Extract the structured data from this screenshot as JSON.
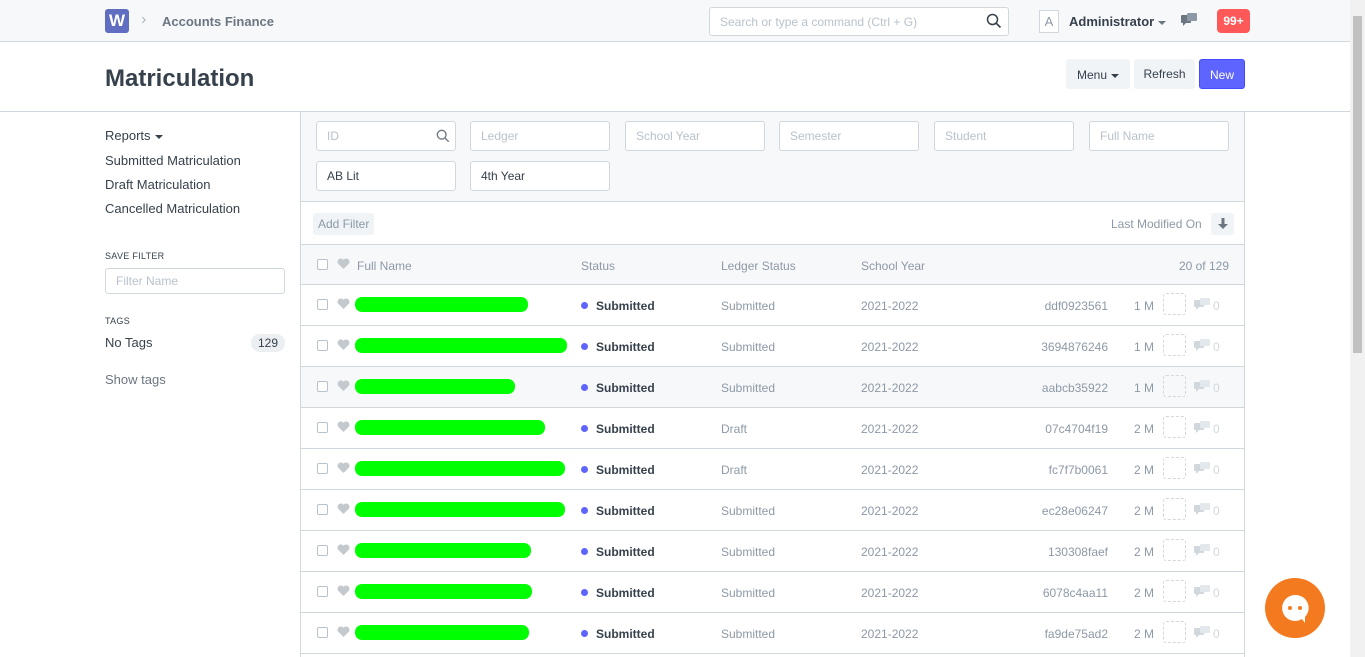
{
  "navbar": {
    "logo_letter": "W",
    "breadcrumb": "Accounts Finance",
    "search_placeholder": "Search or type a command (Ctrl + G)",
    "avatar_letter": "A",
    "user": "Administrator",
    "notification_badge": "99+"
  },
  "page": {
    "title": "Matriculation",
    "menu_label": "Menu",
    "refresh_label": "Refresh",
    "new_label": "New"
  },
  "sidebar": {
    "reports_label": "Reports",
    "links": [
      "Submitted Matriculation",
      "Draft Matriculation",
      "Cancelled Matriculation"
    ],
    "save_filter_heading": "SAVE FILTER",
    "filter_name_placeholder": "Filter Name",
    "tags_heading": "TAGS",
    "no_tags_label": "No Tags",
    "no_tags_count": "129",
    "show_tags": "Show tags"
  },
  "filters": {
    "id_placeholder": "ID",
    "ledger_placeholder": "Ledger",
    "school_year_placeholder": "School Year",
    "semester_placeholder": "Semester",
    "student_placeholder": "Student",
    "full_name_placeholder": "Full Name",
    "program_value": "AB Lit",
    "year_level_value": "4th Year",
    "add_filter": "Add Filter",
    "sort_label": "Last Modified On"
  },
  "list": {
    "columns": {
      "full_name": "Full Name",
      "status": "Status",
      "ledger_status": "Ledger Status",
      "school_year": "School Year"
    },
    "count": "20 of 129",
    "rows": [
      {
        "status": "Submitted",
        "ledger": "Submitted",
        "year": "2021-2022",
        "id": "ddf0923561",
        "time": "1 M",
        "comments": "0",
        "highlight": false
      },
      {
        "status": "Submitted",
        "ledger": "Submitted",
        "year": "2021-2022",
        "id": "3694876246",
        "time": "1 M",
        "comments": "0",
        "highlight": false
      },
      {
        "status": "Submitted",
        "ledger": "Submitted",
        "year": "2021-2022",
        "id": "aabcb35922",
        "time": "1 M",
        "comments": "0",
        "highlight": true
      },
      {
        "status": "Submitted",
        "ledger": "Draft",
        "year": "2021-2022",
        "id": "07c4704f19",
        "time": "2 M",
        "comments": "0",
        "highlight": false
      },
      {
        "status": "Submitted",
        "ledger": "Draft",
        "year": "2021-2022",
        "id": "fc7f7b0061",
        "time": "2 M",
        "comments": "0",
        "highlight": false
      },
      {
        "status": "Submitted",
        "ledger": "Submitted",
        "year": "2021-2022",
        "id": "ec28e06247",
        "time": "2 M",
        "comments": "0",
        "highlight": false
      },
      {
        "status": "Submitted",
        "ledger": "Submitted",
        "year": "2021-2022",
        "id": "130308faef",
        "time": "2 M",
        "comments": "0",
        "highlight": false
      },
      {
        "status": "Submitted",
        "ledger": "Submitted",
        "year": "2021-2022",
        "id": "6078c4aa11",
        "time": "2 M",
        "comments": "0",
        "highlight": false
      },
      {
        "status": "Submitted",
        "ledger": "Submitted",
        "year": "2021-2022",
        "id": "fa9de75ad2",
        "time": "2 M",
        "comments": "0",
        "highlight": false
      }
    ]
  },
  "colors": {
    "primary": "#5e64ff",
    "redaction": "#00ff00",
    "badge": "#ff5858",
    "chat_widget": "#f47a1f"
  },
  "icons": [
    "search-icon",
    "chat-icon",
    "heart-icon",
    "comment-icon",
    "sort-icon",
    "chevron-right-icon"
  ]
}
